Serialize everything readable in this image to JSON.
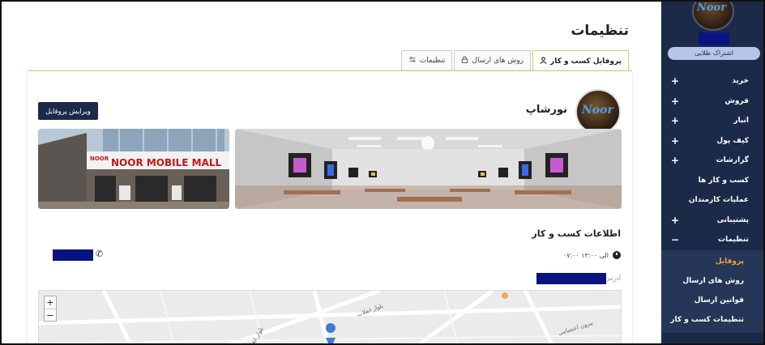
{
  "page_title": "تنظیمات",
  "tabs": [
    {
      "label": "پروفایل کسب و کار",
      "icon": "user-icon",
      "active": true
    },
    {
      "label": "روش های ارسال",
      "icon": "lock-icon",
      "active": false
    },
    {
      "label": "تنظیمات",
      "icon": "sliders-icon",
      "active": false
    }
  ],
  "business": {
    "name": "نورشاپ",
    "logo_text": "Noor",
    "edit_button": "ویرایش پروفایل",
    "store_sign": "NOOR MOBILE MALL",
    "store_sign_small": "NOOR"
  },
  "info": {
    "section_title": "اطلاعات کسب و کار",
    "hours": "۰۷:۰۰ الی ۱۳:۰۰",
    "address_label": "آدرس"
  },
  "map": {
    "zoom_in": "+",
    "zoom_out": "−",
    "labels": [
      "بلوار انقلاب",
      "بیرون اعتصامی",
      "بلوار انقلاب"
    ]
  },
  "sidebar": {
    "logo_text": "Noor",
    "subscription_badge": "اشتراک طلایی",
    "menu": [
      {
        "label": "خرید",
        "expandable": true,
        "toggle": "+"
      },
      {
        "label": "فروش",
        "expandable": true,
        "toggle": "+"
      },
      {
        "label": "انبار",
        "expandable": true,
        "toggle": "+"
      },
      {
        "label": "کیف پول",
        "expandable": true,
        "toggle": "+"
      },
      {
        "label": "گزارشات",
        "expandable": true,
        "toggle": "+"
      },
      {
        "label": "کسب و کار ها",
        "expandable": false
      },
      {
        "label": "عملیات کارمندان",
        "expandable": false
      },
      {
        "label": "پشتیبانی",
        "expandable": true,
        "toggle": "+"
      },
      {
        "label": "تنظیمات",
        "expandable": true,
        "toggle": "−"
      }
    ],
    "submenu": [
      {
        "label": "پروفایل",
        "active": true
      },
      {
        "label": "روش های ارسال",
        "active": false
      },
      {
        "label": "قوانین ارسال",
        "active": false
      },
      {
        "label": "تنظیمات کسب و کار",
        "active": false
      }
    ]
  },
  "colors": {
    "sidebar_bg": "#1c2a4a",
    "accent": "#f0a830",
    "redaction": "#0a1480",
    "tab_border": "#e5c26b"
  }
}
